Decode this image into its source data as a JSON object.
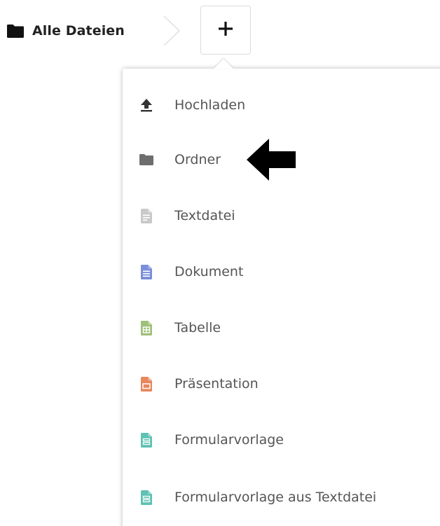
{
  "breadcrumb": {
    "home_label": "Alle Dateien",
    "home_icon": "folder-icon"
  },
  "new_button": {
    "symbol": "+",
    "icon": "plus-icon"
  },
  "menu": {
    "items": [
      {
        "label": "Hochladen",
        "icon": "upload-icon",
        "color": "#333333"
      },
      {
        "label": "Ordner",
        "icon": "folder-icon",
        "color": "#6e6e6e"
      },
      {
        "label": "Textdatei",
        "icon": "text-file-icon",
        "color": "#c2c2c2"
      },
      {
        "label": "Dokument",
        "icon": "document-icon",
        "color": "#7b8fd8"
      },
      {
        "label": "Tabelle",
        "icon": "spreadsheet-icon",
        "color": "#9fc07a"
      },
      {
        "label": "Präsentation",
        "icon": "presentation-icon",
        "color": "#e8875d"
      },
      {
        "label": "Formularvorlage",
        "icon": "form-template-icon",
        "color": "#5ec1b3"
      },
      {
        "label": "Formularvorlage aus Textdatei",
        "icon": "form-template-icon",
        "color": "#5ec1b3"
      }
    ]
  },
  "annotation": {
    "icon": "black-arrow-left-icon"
  }
}
